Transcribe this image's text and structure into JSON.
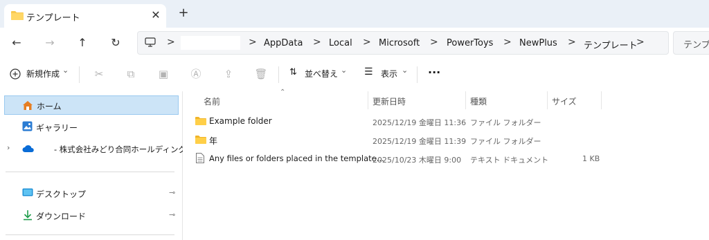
{
  "tab": {
    "title": "テンプレート",
    "close_glyph": "✕",
    "new_tab_glyph": "+"
  },
  "nav": {
    "back": "←",
    "forward": "→",
    "up": "↑",
    "refresh": "↻",
    "breadcrumb": [
      "AppData",
      "Local",
      "Microsoft",
      "PowerToys",
      "NewPlus",
      "テンプレート"
    ],
    "separator": ">",
    "search_placeholder": "テンプレ"
  },
  "toolbar": {
    "new_label": "新規作成",
    "sort_label": "並べ替え",
    "view_label": "表示",
    "more_label": "···",
    "dropdown_glyph": "⌄"
  },
  "sidebar": {
    "home": "ホーム",
    "gallery": "ギャラリー",
    "onedrive": "- 株式会社みどり合同ホールディングス",
    "desktop": "デスクトップ",
    "downloads": "ダウンロード",
    "pin_glyph": "📌"
  },
  "columns": {
    "name": "名前",
    "date": "更新日時",
    "type": "種類",
    "size": "サイズ"
  },
  "files": [
    {
      "name": "Example folder",
      "date": "2025/12/19 金曜日 11:36",
      "type": "ファイル フォルダー",
      "size": ""
    },
    {
      "name": "年",
      "date": "2025/12/19 金曜日 11:39",
      "type": "ファイル フォルダー",
      "size": ""
    },
    {
      "name": "Any files or folders placed in the template...",
      "date": "2025/10/23 木曜日 9:00",
      "type": "テキスト ドキュメント",
      "size": "1 KB"
    }
  ],
  "colors": {
    "accent": "#0067c0",
    "folder": "#f8c84e",
    "selection": "#cce4f7"
  },
  "icons": [
    "folder-icon",
    "home-icon",
    "gallery-icon",
    "cloud-icon",
    "desktop-icon",
    "download-icon",
    "text-file-icon",
    "pc-icon"
  ]
}
